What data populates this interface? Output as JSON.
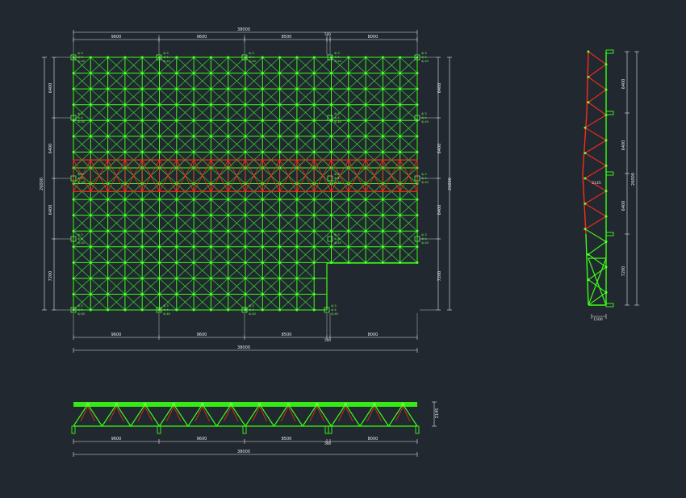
{
  "colors": {
    "background": "#212830",
    "member": "#39ff14",
    "member_dim": "#2fd42a",
    "highlight": "#ff2a1a",
    "dimension": "#e8e8e8",
    "node": "#5cff3a",
    "support_text": "#7dff5e"
  },
  "plan": {
    "top_total": "38000",
    "top_spans": [
      "9600",
      "9600",
      "8500",
      "500",
      "8000"
    ],
    "bottom_spans": [
      "9600",
      "9600",
      "8500",
      "500",
      "8000"
    ],
    "bottom_total": "38000",
    "left_spans": [
      "6400",
      "6400",
      "6400",
      "7200"
    ],
    "left_total": "26000",
    "right_spans": [
      "6400",
      "6400",
      "6400",
      "7200"
    ],
    "right_total": "26000",
    "support_labels": [
      "4/-3",
      "4/-4",
      "4/-40"
    ]
  },
  "section": {
    "height_label": "2145",
    "spans": [
      "9600",
      "9600",
      "8500",
      "500",
      "8000"
    ],
    "total": "38000"
  },
  "side_view": {
    "spans": [
      "6400",
      "6400",
      "6400",
      "7200"
    ],
    "total": "26000",
    "depth_label": "2145",
    "base_label": "1500"
  }
}
